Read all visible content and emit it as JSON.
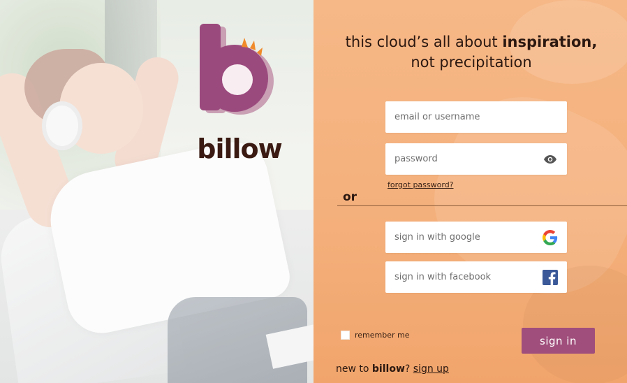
{
  "brand": {
    "name": "billow",
    "logo_colors": {
      "primary": "#9b4a7e",
      "shadow": "#c9a0b4",
      "spark": "#f08a2a",
      "text": "#3a1a12"
    }
  },
  "hero": {
    "tagline_line1_prefix": "this cloud’s all about",
    "tagline_line1_bold": "inspiration,",
    "tagline_line2": "not precipitation"
  },
  "login": {
    "email_placeholder": "email or username",
    "password_placeholder": "password",
    "show_password_icon": "eye-icon",
    "forgot_password": "forgot password?",
    "divider_label": "or",
    "google_label": "sign in with google",
    "facebook_label": "sign in with facebook",
    "remember_label": "remember me",
    "remember_checked": false,
    "signin_button": "sign in",
    "signup_prefix": "new to",
    "signup_brand": "billow",
    "signup_suffix": "?",
    "signup_link": "sign up"
  },
  "colors": {
    "accent": "#a04e7c",
    "panel": "#f4b07c",
    "text_dark": "#2b1810"
  }
}
